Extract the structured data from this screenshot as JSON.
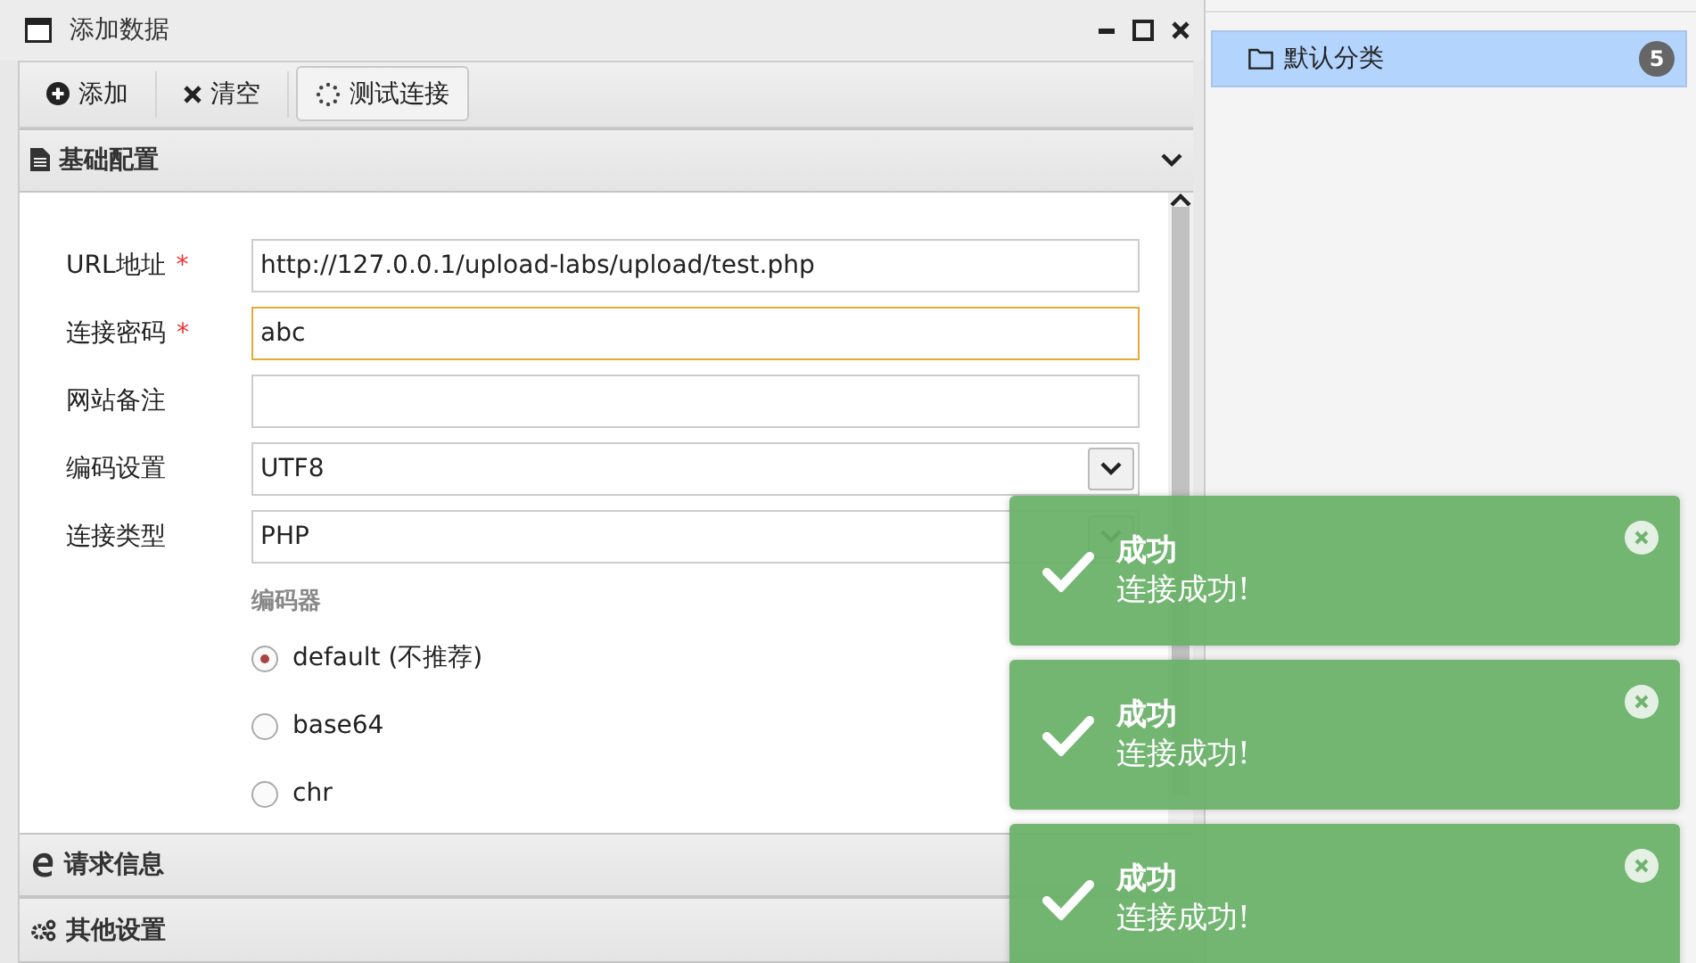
{
  "window": {
    "title": "添加数据"
  },
  "toolbar": [
    {
      "kind": "add",
      "label": "添加"
    },
    {
      "kind": "clear",
      "label": "清空"
    },
    {
      "kind": "test",
      "label": "测试连接"
    }
  ],
  "sections": [
    {
      "kind": "file",
      "title": "基础配置",
      "expanded": true
    },
    {
      "kind": "edge",
      "title": "请求信息",
      "expanded": false
    },
    {
      "kind": "gears",
      "title": "其他设置",
      "expanded": false
    }
  ],
  "form": {
    "fields": [
      {
        "kind": "text",
        "label": "URL地址",
        "marker": "*",
        "value": "http://127.0.0.1/upload-labs/upload/test.php",
        "focused": false
      },
      {
        "kind": "text",
        "label": "连接密码",
        "marker": "*",
        "value": "abc",
        "focused": true
      },
      {
        "kind": "text",
        "label": "网站备注",
        "focused": false
      },
      {
        "kind": "select",
        "label": "编码设置",
        "value": "UTF8"
      },
      {
        "kind": "select",
        "label": "连接类型",
        "value": "PHP"
      }
    ],
    "encoder": {
      "label": "编码器",
      "options": [
        {
          "label": "default (不推荐)",
          "selected": true
        },
        {
          "label": "base64",
          "selected": false
        },
        {
          "label": "chr",
          "selected": false
        }
      ]
    }
  },
  "categories": [
    {
      "label": "默认分类",
      "count": "5",
      "selected": true
    }
  ],
  "toasts": [
    {
      "title": "成功",
      "message": "连接成功!"
    },
    {
      "title": "成功",
      "message": "连接成功!"
    },
    {
      "title": "成功",
      "message": "连接成功!"
    }
  ]
}
